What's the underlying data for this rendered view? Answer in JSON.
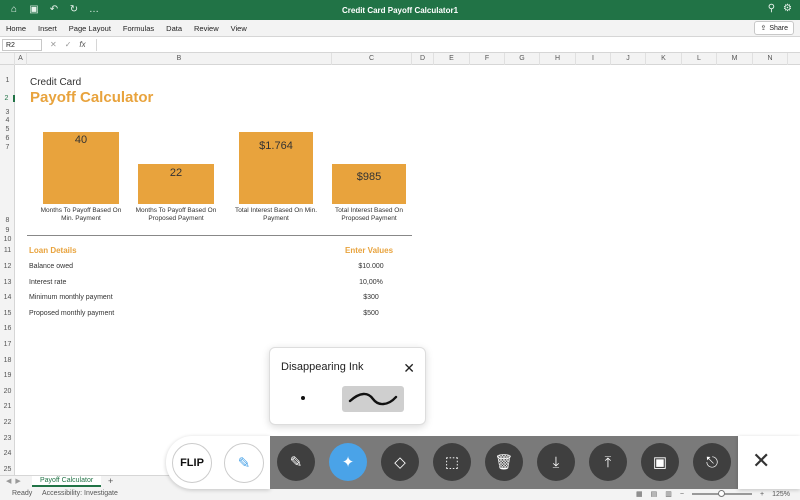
{
  "app": {
    "title": "Credit Card Payoff Calculator1",
    "menu": [
      "Home",
      "Insert",
      "Page Layout",
      "Formulas",
      "Data",
      "Review",
      "View"
    ],
    "share_label": "Share",
    "name_box": "R2",
    "fx_label": "fx"
  },
  "columns": [
    "A",
    "B",
    "C",
    "D",
    "E",
    "F",
    "G",
    "H",
    "I",
    "J",
    "K",
    "L",
    "M",
    "N"
  ],
  "rows": [
    "1",
    "2",
    "3",
    "4",
    "5",
    "6",
    "7",
    "8",
    "9",
    "10",
    "11",
    "12",
    "13",
    "14",
    "15",
    "16",
    "17",
    "18",
    "19",
    "20",
    "21",
    "22",
    "23",
    "24",
    "25"
  ],
  "sheet": {
    "title_small": "Credit Card",
    "title_big": "Payoff Calculator",
    "bars": [
      {
        "value": "40",
        "num": 40,
        "label_line1": "Months To Payoff Based On",
        "label_line2": "Min. Payment"
      },
      {
        "value": "22",
        "num": 22,
        "label_line1": "Months To Payoff Based On",
        "label_line2": "Proposed Payment"
      },
      {
        "value": "$1.764",
        "num": 1764,
        "label_line1": "Total Interest Based On Min.",
        "label_line2": "Payment"
      },
      {
        "value": "$985",
        "num": 985,
        "label_line1": "Total Interest Based On",
        "label_line2": "Proposed Payment"
      }
    ],
    "loan_header": "Loan Details",
    "values_header": "Enter Values",
    "loan_rows": [
      {
        "label": "Balance owed",
        "value": "$10.000"
      },
      {
        "label": "Interest rate",
        "value": "10,00%"
      },
      {
        "label": "Minimum monthly payment",
        "value": "$300"
      },
      {
        "label": "Proposed monthly payment",
        "value": "$500"
      }
    ]
  },
  "sheet_tabs": {
    "active": "Payoff Calculator",
    "add": "+"
  },
  "status": {
    "ready": "Ready",
    "accessibility": "Accessibility: Investigate",
    "zoom": "125%"
  },
  "popup": {
    "title": "Disappearing Ink"
  },
  "toolbar": {
    "flip_label": "FLIP",
    "tools": [
      "pen-icon",
      "magic-wand-icon",
      "eraser-icon",
      "select-icon",
      "trash-icon",
      "download-icon",
      "upload-icon",
      "save-icon",
      "exit-icon"
    ]
  },
  "colors": {
    "excel_green": "#217346",
    "accent_orange": "#e8a33d",
    "active_tool": "#4aa3e8"
  }
}
